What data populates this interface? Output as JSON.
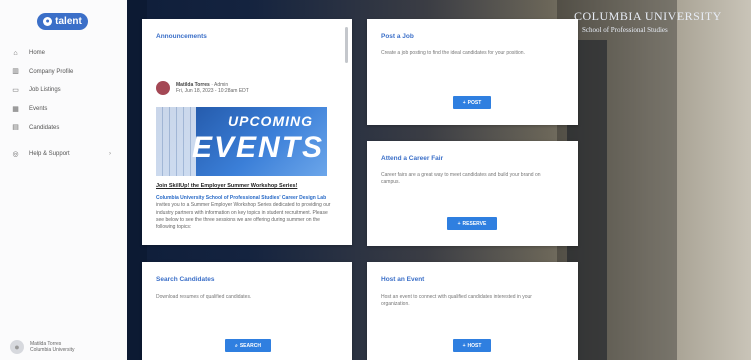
{
  "logo": {
    "text": "talent"
  },
  "nav": [
    {
      "label": "Home",
      "icon": "home-icon"
    },
    {
      "label": "Company Profile",
      "icon": "building-icon"
    },
    {
      "label": "Job Listings",
      "icon": "briefcase-icon"
    },
    {
      "label": "Events",
      "icon": "calendar-icon"
    },
    {
      "label": "Candidates",
      "icon": "document-icon"
    }
  ],
  "support": {
    "label": "Help & Support",
    "icon": "help-icon"
  },
  "user": {
    "name": "Matilda Torres",
    "org": "Columbia University"
  },
  "banner": {
    "line1": "COLUMBIA UNIVERSITY",
    "line2": "School of Professional Studies"
  },
  "announcements": {
    "title": "Announcements",
    "author": "Matilda Torres",
    "role": "Admin",
    "date": "Fri, Jun 18, 2023 - 10:28am EDT",
    "poster_top": "UPCOMING",
    "poster_main": "EVENTS",
    "headline": "Join SkillUp! the Employer Summer Workshop Series!",
    "link_text": "Columbia University School of Professional Studies' Career Design Lab",
    "body": "invites you to a Summer Employer Workshop Series dedicated to providing our industry partners with information on key topics in student recruitment. Please see below to see the three sessions we are offering during summer on the following topics:"
  },
  "post_job": {
    "title": "Post a Job",
    "desc": "Create a job posting to find the ideal candidates for your position.",
    "button": "POST"
  },
  "career_fair": {
    "title": "Attend a Career Fair",
    "desc": "Career fairs are a great way to meet candidates and build your brand on campus.",
    "button": "RESERVE"
  },
  "search_candidates": {
    "title": "Search Candidates",
    "desc": "Download resumes of qualified candidates.",
    "button": "SEARCH"
  },
  "host_event": {
    "title": "Host an Event",
    "desc": "Host an event to connect with qualified candidates interested in your organization.",
    "button": "HOST"
  },
  "colors": {
    "accent": "#2f7fe0",
    "title": "#3b6fc8",
    "stage": "#14233f"
  }
}
